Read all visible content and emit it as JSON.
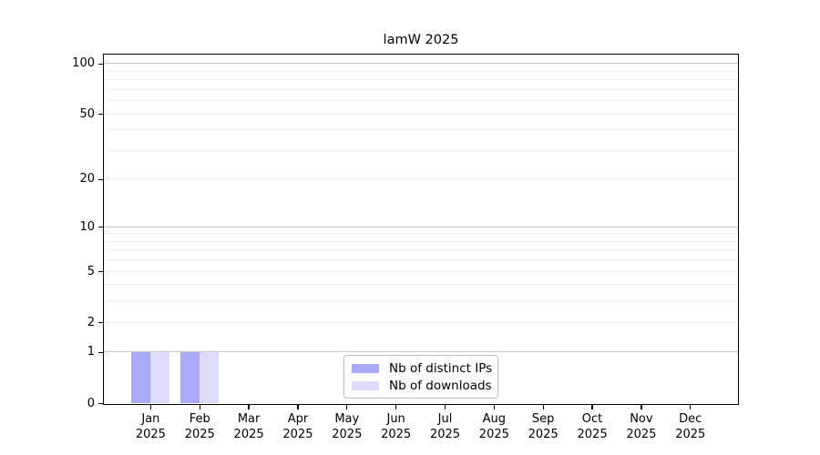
{
  "chart_data": {
    "type": "bar",
    "title": "lamW 2025",
    "categories": [
      "Jan 2025",
      "Feb 2025",
      "Mar 2025",
      "Apr 2025",
      "May 2025",
      "Jun 2025",
      "Jul 2025",
      "Aug 2025",
      "Sep 2025",
      "Oct 2025",
      "Nov 2025",
      "Dec 2025"
    ],
    "series": [
      {
        "name": "Nb of distinct IPs",
        "color": "#a8aaf7",
        "values": [
          1,
          1,
          0,
          0,
          0,
          0,
          0,
          0,
          0,
          0,
          0,
          0
        ]
      },
      {
        "name": "Nb of downloads",
        "color": "#dcdcfa",
        "values": [
          1,
          1,
          0,
          0,
          0,
          0,
          0,
          0,
          0,
          0,
          0,
          0
        ]
      }
    ],
    "xlabel": "",
    "ylabel": "",
    "yscale": "log1p",
    "ylim": [
      0,
      114
    ],
    "yticks": [
      0,
      1,
      2,
      5,
      10,
      20,
      50,
      100
    ],
    "grid": true,
    "grid_major_values": [
      1,
      10,
      100
    ],
    "grid_minor_values": [
      2,
      3,
      4,
      5,
      6,
      7,
      8,
      9,
      20,
      30,
      40,
      50,
      60,
      70,
      80,
      90
    ],
    "grid_major_color": "#c6c6c6",
    "grid_minor_color": "#ececec",
    "legend_position": "lower center",
    "spine_color": "#000000",
    "background_color": "#ffffff"
  }
}
